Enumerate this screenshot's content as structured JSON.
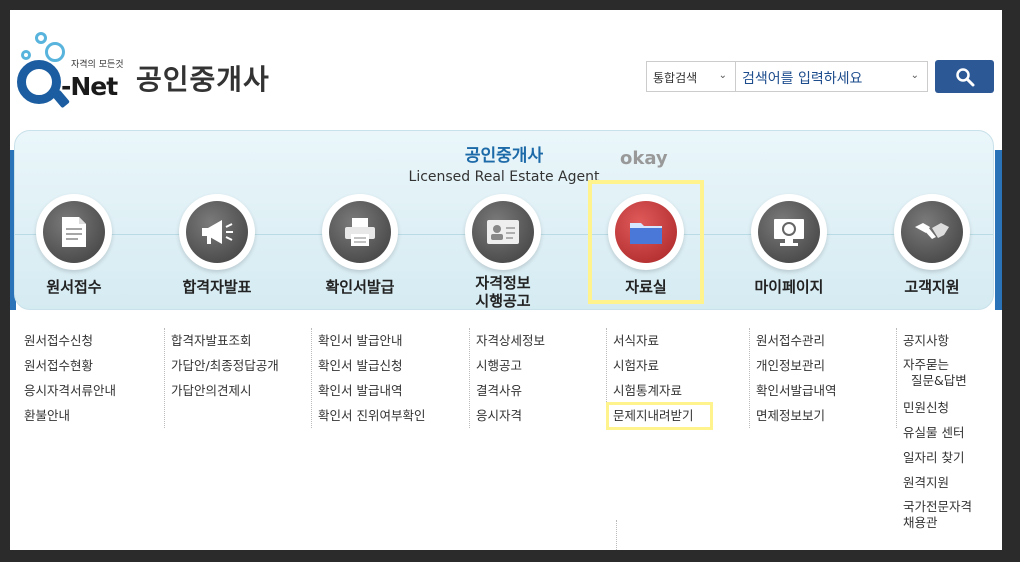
{
  "header": {
    "logo_tagline": "자격의 모든것",
    "logo_text": "-Net",
    "logo_q": "Q",
    "site_title": "공인중개사"
  },
  "search": {
    "scope_value": "통합검색",
    "input_value": "검색어를 입력하세요",
    "button_icon": "search-icon"
  },
  "banner": {
    "title": "공인중개사",
    "subtitle": "Licensed Real Estate Agent",
    "annotation": "okay"
  },
  "menu": [
    {
      "label": "원서접수",
      "icon": "document-icon"
    },
    {
      "label": "합격자발표",
      "icon": "megaphone-icon"
    },
    {
      "label": "확인서발급",
      "icon": "printer-icon"
    },
    {
      "label": "자격정보\n시행공고",
      "icon": "id-card-icon"
    },
    {
      "label": "자료실",
      "icon": "folder-icon"
    },
    {
      "label": "마이페이지",
      "icon": "monitor-icon"
    },
    {
      "label": "고객지원",
      "icon": "handshake-icon"
    }
  ],
  "submenus": [
    [
      "원서접수신청",
      "원서접수현황",
      "응시자격서류안내",
      "환불안내"
    ],
    [
      "합격자발표조회",
      "가답안/최종정답공개",
      "가답안의견제시"
    ],
    [
      "확인서 발급안내",
      "확인서 발급신청",
      "확인서 발급내역",
      "확인서 진위여부확인"
    ],
    [
      "자격상세정보",
      "시행공고",
      "결격사유",
      "응시자격"
    ],
    [
      "서식자료",
      "시험자료",
      "시험통계자료",
      "문제지내려받기"
    ],
    [
      "원서접수관리",
      "개인정보관리",
      "확인서발급내역",
      "면제정보보기"
    ],
    [
      "공지사항",
      "자주묻는\n질문&답변",
      "민원신청",
      "유실물 센터",
      "일자리 찾기",
      "원격지원",
      "국가전문자격\n채용관"
    ]
  ],
  "colors": {
    "brand_blue": "#1b5da0",
    "button_blue": "#2d5896",
    "active_red": "#c0392b",
    "highlight_yellow": "#fff38d"
  }
}
